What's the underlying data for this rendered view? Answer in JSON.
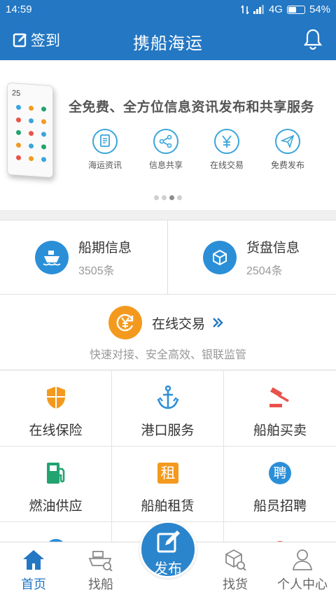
{
  "status_bar": {
    "time": "14:59",
    "network": "4G",
    "battery": "54%",
    "battery_level": 0.54
  },
  "header": {
    "signin_label": "签到",
    "title": "携船海运"
  },
  "banner": {
    "headline": "全免费、全方位信息资讯发布和共享服务",
    "phone_clock": "25",
    "features": [
      {
        "label": "海运资讯",
        "icon": "document-icon"
      },
      {
        "label": "信息共享",
        "icon": "share-icon"
      },
      {
        "label": "在线交易",
        "icon": "yen-icon"
      },
      {
        "label": "免费发布",
        "icon": "paper-plane-icon"
      }
    ],
    "page_count": 4,
    "active_page": 3
  },
  "info_cards": [
    {
      "title": "船期信息",
      "count": "3505条",
      "icon": "ship-icon"
    },
    {
      "title": "货盘信息",
      "count": "2504条",
      "icon": "box-icon"
    }
  ],
  "trade": {
    "title": "在线交易",
    "subtitle": "快速对接、安全高效、银联监管",
    "icon": "yen-refresh-icon"
  },
  "services": [
    {
      "label": "在线保险",
      "icon": "shield-icon"
    },
    {
      "label": "港口服务",
      "icon": "anchor-icon"
    },
    {
      "label": "船舶买卖",
      "icon": "gavel-icon"
    },
    {
      "label": "燃油供应",
      "icon": "fuel-pump-icon"
    },
    {
      "label": "船舶租赁",
      "icon": "rent-icon",
      "badge_char": "租"
    },
    {
      "label": "船员招聘",
      "icon": "hire-icon",
      "badge_char": "聘"
    }
  ],
  "tabs": [
    {
      "label": "首页",
      "icon": "home-icon",
      "active": true
    },
    {
      "label": "找船",
      "icon": "ship-icon",
      "active": false
    },
    {
      "label": "发布",
      "icon": "edit-icon",
      "active": false
    },
    {
      "label": "找货",
      "icon": "search-box-icon",
      "active": false
    },
    {
      "label": "个人中心",
      "icon": "person-icon",
      "active": false
    }
  ],
  "colors": {
    "primary": "#2377c3",
    "accent_blue": "#2b8fd8",
    "orange": "#f39a1e",
    "red": "#e9524a",
    "green": "#22a36f"
  }
}
